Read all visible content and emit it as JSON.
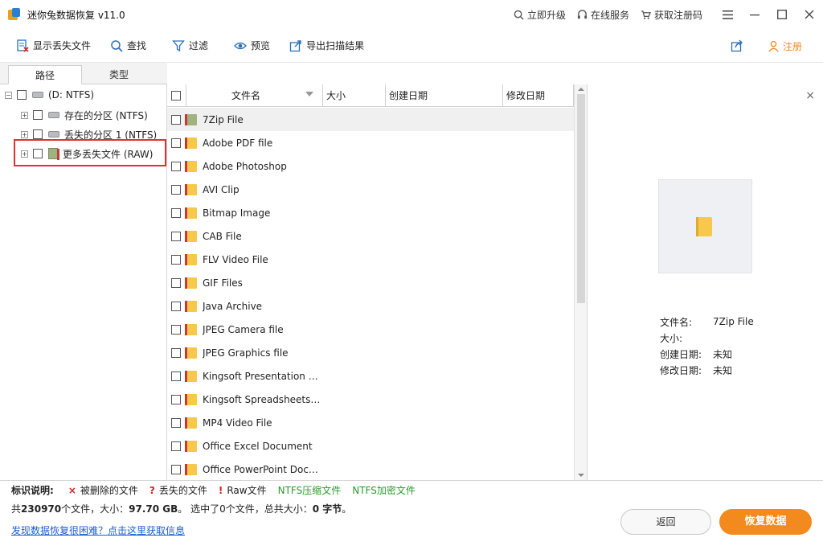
{
  "window": {
    "title": "迷你兔数据恢复 v11.0",
    "links": [
      {
        "label": "立即升级",
        "icon": "search-icon"
      },
      {
        "label": "在线服务",
        "icon": "headset-icon"
      },
      {
        "label": "获取注册码",
        "icon": "cart-icon"
      }
    ]
  },
  "toolbar": {
    "show_lost": "显示丢失文件",
    "find": "查找",
    "filter": "过滤",
    "preview": "预览",
    "export": "导出扫描结果",
    "register": "注册"
  },
  "tabs": {
    "path": "路径",
    "type": "类型"
  },
  "tree": {
    "root": "(D: NTFS)",
    "existing": "存在的分区 (NTFS)",
    "lost": "丢失的分区 1 (NTFS)",
    "more": "更多丢失文件 (RAW)"
  },
  "list": {
    "headers": {
      "name": "文件名",
      "size": "大小",
      "created": "创建日期",
      "modified": "修改日期"
    },
    "rows": [
      "7Zip File",
      "Adobe PDF file",
      "Adobe Photoshop",
      "AVI Clip",
      "Bitmap Image",
      "CAB File",
      "FLV Video File",
      "GIF Files",
      "Java Archive",
      "JPEG Camera file",
      "JPEG Graphics file",
      "Kingsoft Presentation Do…",
      "Kingsoft Spreadsheets File",
      "MP4 Video File",
      "Office Excel Document",
      "Office PowerPoint Docum…"
    ]
  },
  "preview": {
    "name_label": "文件名:",
    "name_value": "7Zip File",
    "size_label": "大小:",
    "created_label": "创建日期:",
    "created_value": "未知",
    "modified_label": "修改日期:",
    "modified_value": "未知"
  },
  "legend": {
    "title": "标识说明:",
    "deleted": "被删除的文件",
    "lost": "丢失的文件",
    "raw": "Raw文件",
    "ntfs_compressed": "NTFS压缩文件",
    "ntfs_encrypted": "NTFS加密文件"
  },
  "summary": {
    "prefix": "共",
    "count": "230970",
    "mid1": "个文件，大小：",
    "size": "97.70 GB",
    "mid2": "。 选中了",
    "selected": "0",
    "mid3": "个文件，总共大小：",
    "total": "0 字节",
    "suffix": "。"
  },
  "help_link": "发现数据恢复很困难？点击这里获取信息",
  "buttons": {
    "back": "返回",
    "recover": "恢复数据"
  },
  "colors": {
    "accent": "#f38a1d",
    "link": "#1a5ecf",
    "highlight": "#e03030"
  }
}
